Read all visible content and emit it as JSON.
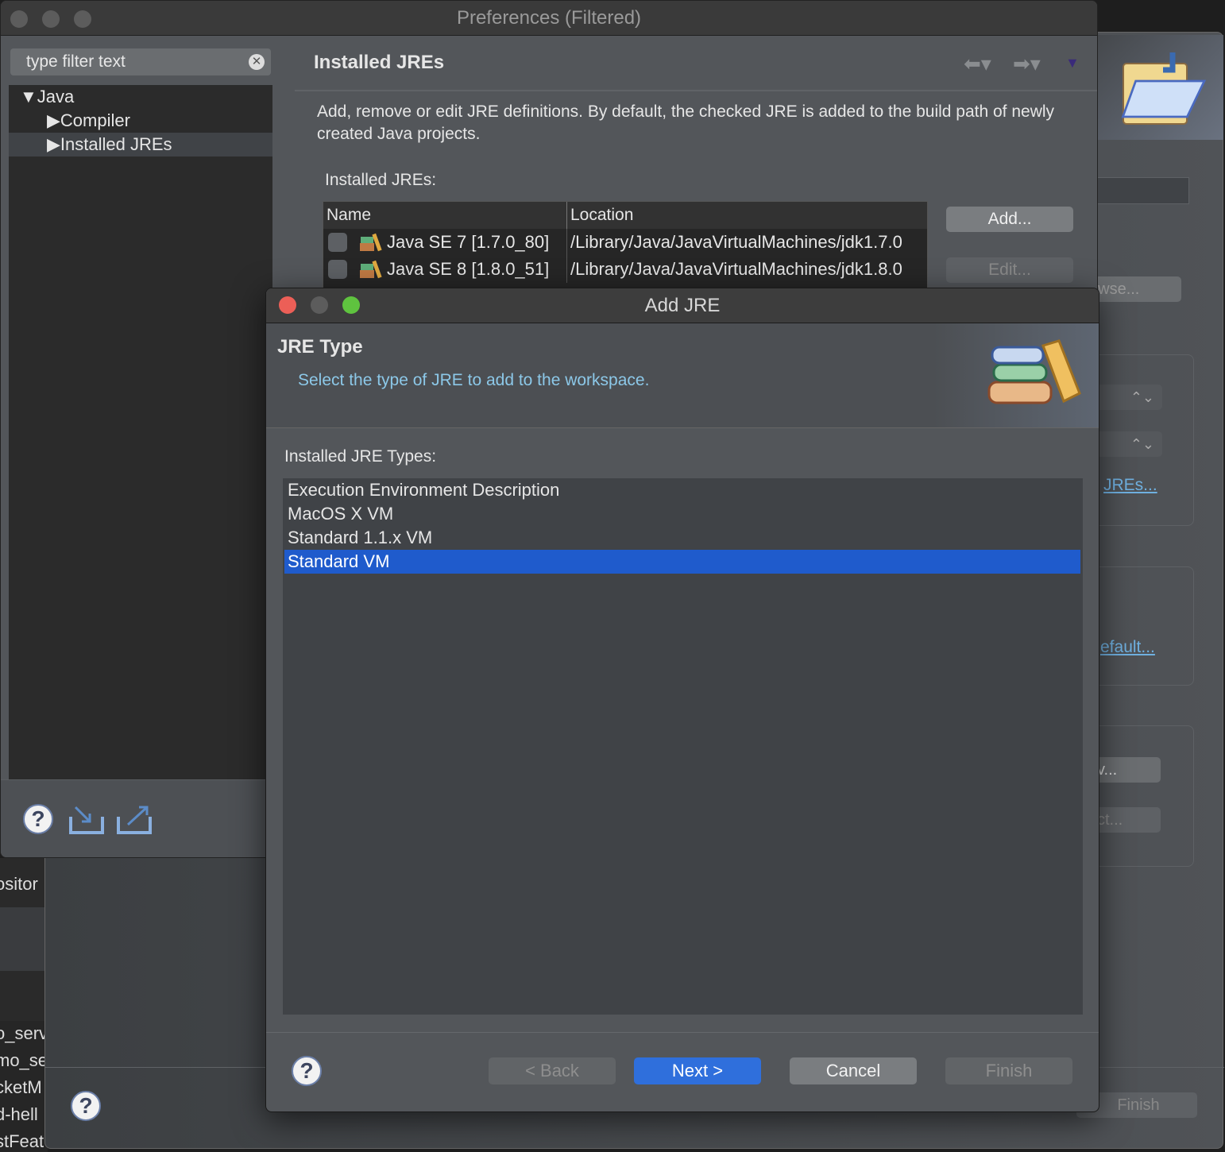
{
  "background_editor": {
    "lines": [
      "ositor",
      "o_serv",
      "mo_se",
      "cketM",
      "d-hell",
      "stFeat"
    ]
  },
  "background_wizard": {
    "link_jres": "JREs...",
    "link_default": "efault...",
    "btn_browse": "owse...",
    "btn_new": "v...",
    "btn_select": "ct...",
    "btn_finish": "Finish"
  },
  "preferences": {
    "title": "Preferences (Filtered)",
    "filter": {
      "placeholder": "type filter text"
    },
    "tree": [
      {
        "label": "Java",
        "expanded": true
      },
      {
        "label": "Compiler",
        "expanded": false
      },
      {
        "label": "Installed JREs",
        "expanded": false,
        "selected": true
      }
    ],
    "page": {
      "title": "Installed JREs",
      "description": "Add, remove or edit JRE definitions. By default, the checked JRE is added to the build path of newly created Java projects.",
      "table_label": "Installed JREs:",
      "columns": [
        "Name",
        "Location"
      ],
      "rows": [
        {
          "name": "Java SE 7 [1.7.0_80]",
          "location": "/Library/Java/JavaVirtualMachines/jdk1.7.0",
          "checked": false
        },
        {
          "name": "Java SE 8 [1.8.0_51]",
          "location": "/Library/Java/JavaVirtualMachines/jdk1.8.0",
          "checked": false
        }
      ],
      "add_button": "Add...",
      "edit_button": "Edit..."
    }
  },
  "dialog": {
    "title": "Add JRE",
    "heading": "JRE Type",
    "subtitle": "Select the type of JRE to add to the workspace.",
    "list_label": "Installed JRE Types:",
    "types": [
      {
        "label": "Execution Environment Description",
        "selected": false
      },
      {
        "label": "MacOS X VM",
        "selected": false
      },
      {
        "label": "Standard 1.1.x VM",
        "selected": false
      },
      {
        "label": "Standard VM",
        "selected": true
      }
    ],
    "buttons": {
      "back": "< Back",
      "next": "Next >",
      "cancel": "Cancel",
      "finish": "Finish"
    },
    "colors": {
      "selection": "#1f5bcc",
      "primary_button": "#2f6fdc",
      "subtitle": "#8cc8e8",
      "close": "#ec5f57",
      "zoom": "#5fc33f"
    }
  }
}
